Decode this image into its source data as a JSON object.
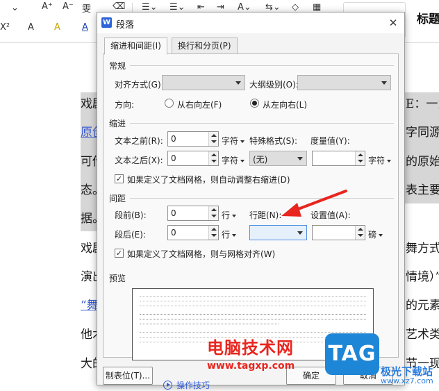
{
  "background": {
    "toolbar_row1": [
      "A⁺",
      "A⁻",
      "雯",
      "⌫"
    ],
    "toolbar_row2": [
      "X²",
      "A",
      "A",
      "A"
    ],
    "style_label": "标题",
    "doc_fragments": [
      {
        "text": "戏剧",
        "link": false
      },
      {
        "text": "原创",
        "link": true
      },
      {
        "text": "可借",
        "link": false
      },
      {
        "text": "态。",
        "link": false
      },
      {
        "text": "据。",
        "link": false
      },
      {
        "text": "戏剧",
        "link": false
      },
      {
        "text": "演出",
        "link": false
      },
      {
        "text": "“舞",
        "link": true
      },
      {
        "text": "他术",
        "link": false
      },
      {
        "text": "大的",
        "link": false
      }
    ],
    "doc_right_fragments": [
      "E：一为",
      "字同源",
      "的原始形",
      "表主要作",
      "舞方式表",
      "情境）”",
      "的元素",
      "艺术类剧",
      "节一现角"
    ]
  },
  "dialog": {
    "title": "段落",
    "app_icon_letter": "W",
    "close_symbol": "✕",
    "tabs": [
      "缩进和间距(I)",
      "换行和分页(P)"
    ],
    "general": {
      "heading": "常规",
      "alignment_label": "对齐方式(G):",
      "alignment_value": "",
      "outline_label": "大纲级别(O):",
      "outline_value": "",
      "direction_label": "方向:",
      "rtl_label": "从右向左(F)",
      "ltr_label": "从左向右(L)",
      "direction_selected": "ltr"
    },
    "indent": {
      "heading": "缩进",
      "before_label": "文本之前(R):",
      "before_value": "0",
      "after_label": "文本之后(X):",
      "after_value": "0",
      "unit": "字符",
      "special_label": "特殊格式(S):",
      "special_value": "(无)",
      "measure_label": "度量值(Y):",
      "measure_value": "",
      "measure_unit": "字符",
      "auto_adjust_label": "如果定义了文档网格，则自动调整右缩进(D)",
      "auto_adjust_checked": true
    },
    "spacing": {
      "heading": "间距",
      "before_label": "段前(B):",
      "before_value": "0",
      "after_label": "段后(E):",
      "after_value": "0",
      "unit": "行",
      "line_label": "行距(N):",
      "line_value": "",
      "setting_label": "设置值(A):",
      "setting_value": "",
      "setting_unit": "磅",
      "snap_label": "如果定义了文档网格，则与网格对齐(W)",
      "snap_checked": true
    },
    "preview": {
      "heading": "预览"
    },
    "buttons": {
      "tabs_button": "制表位(T)...",
      "tips": "操作技巧",
      "ok": "确定",
      "cancel": "取消"
    }
  },
  "watermark": {
    "text": "电脑技术网",
    "url": "www.tagxp.com",
    "logo": "TAG",
    "right_text": "极光下载站",
    "right_url": "www.xz7.com"
  },
  "colors": {
    "annotation_arrow": "#e8251e",
    "accent": "#2d63d8",
    "watermark_blue": "#1e86d6"
  }
}
